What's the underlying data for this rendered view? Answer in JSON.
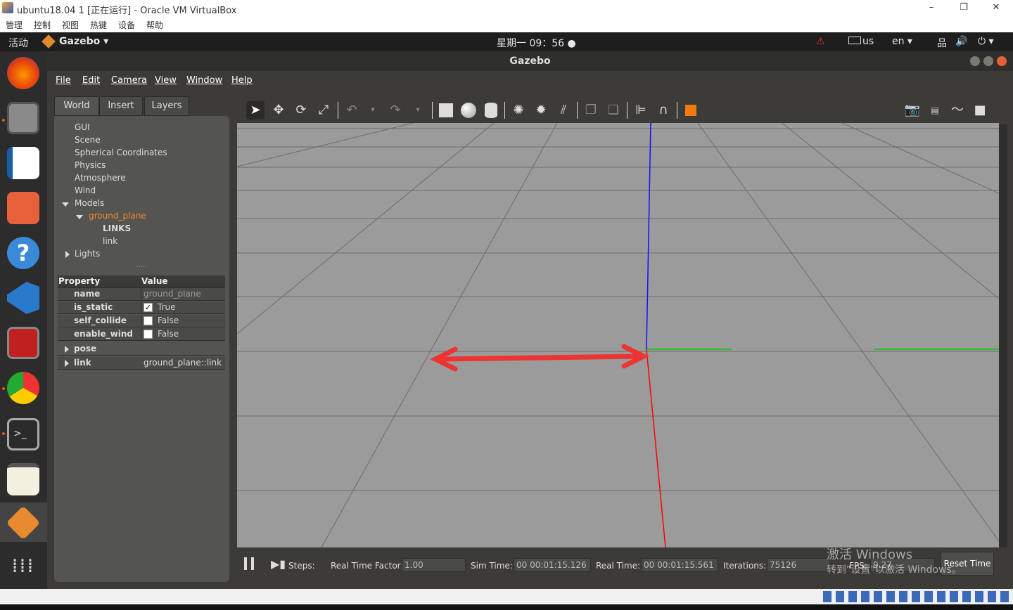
{
  "vbox": {
    "title": "ubuntu18.04 1 [正在运行] - Oracle VM VirtualBox",
    "menu": [
      "管理",
      "控制",
      "视图",
      "热键",
      "设备",
      "帮助"
    ],
    "win_min": "–",
    "win_max": "❐",
    "win_close": "✕"
  },
  "topbar": {
    "activities": "活动",
    "app": "Gazebo ▾",
    "clock": "星期一 09：56 ●",
    "warning": "⚠",
    "keyboard": "us",
    "lang": "en ▾",
    "net": "品",
    "vol": "🔊",
    "power": "⏻ ▾"
  },
  "gazebo": {
    "title": "Gazebo",
    "menu": [
      "File",
      "Edit",
      "Camera",
      "View",
      "Window",
      "Help"
    ],
    "tabs": [
      "World",
      "Insert",
      "Layers"
    ],
    "tree": {
      "gui": "GUI",
      "scene": "Scene",
      "spherical": "Spherical Coordinates",
      "physics": "Physics",
      "atmosphere": "Atmosphere",
      "wind": "Wind",
      "models": "Models",
      "ground_plane": "ground_plane",
      "links": "LINKS",
      "link": "link",
      "lights": "Lights"
    },
    "splitter": ".....",
    "properties": {
      "header_property": "Property",
      "header_value": "Value",
      "name_label": "name",
      "name_value": "ground_plane",
      "is_static_label": "is_static",
      "is_static_value": "True",
      "self_collide_label": "self_collide",
      "self_collide_value": "False",
      "enable_wind_label": "enable_wind",
      "enable_wind_value": "False",
      "pose_label": "pose",
      "link_label": "link",
      "link_value": "ground_plane::link"
    },
    "bottom": {
      "steps_label": "Steps:",
      "rtf_label": "Real Time Factor:",
      "rtf_value": "1.00",
      "sim_time_label": "Sim Time:",
      "sim_time_value": "00 00:01:15.126",
      "real_time_label": "Real Time:",
      "real_time_value": "00 00:01:15.561",
      "iterations_label": "Iterations:",
      "iterations_value": "75126",
      "fps_label": "FPS:",
      "fps_value": "9.27",
      "reset_label": "Reset Time"
    },
    "watermark_line1": "激活 Windows",
    "watermark_line2": "转到\"设置\"以激活 Windows。"
  },
  "colors": {
    "x_axis": "#ff0000",
    "y_axis": "#00cc00",
    "z_axis": "#0000ff",
    "annotation_arrow": "#ee3333",
    "selection": "#f28a2c"
  }
}
